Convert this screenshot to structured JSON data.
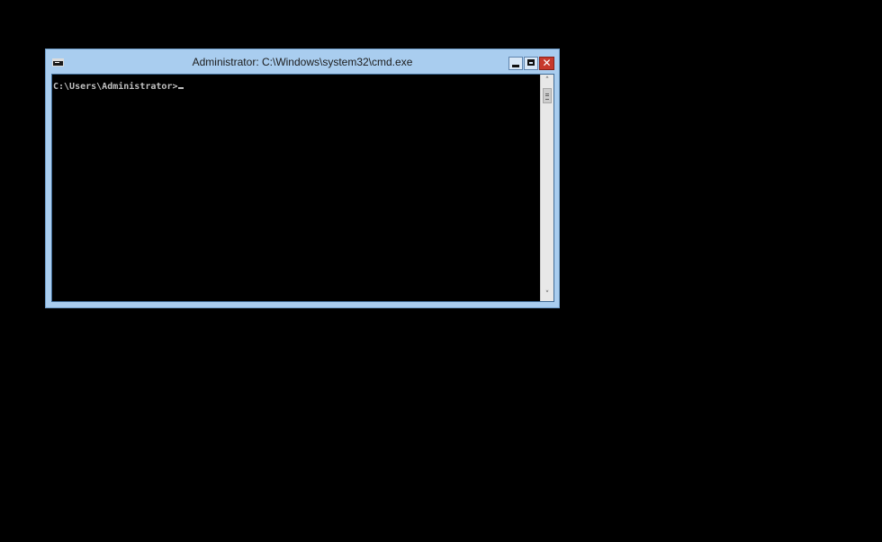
{
  "window": {
    "title": "Administrator: C:\\Windows\\system32\\cmd.exe",
    "icon": "cmd-console-icon",
    "buttons": {
      "minimize_icon": "minimize-icon",
      "maximize_icon": "maximize-icon",
      "close_icon": "close-icon",
      "close_glyph": "✕"
    }
  },
  "console": {
    "prompt": "C:\\Users\\Administrator>"
  },
  "scrollbar": {
    "up_glyph": "˄",
    "down_glyph": "˅"
  },
  "colors": {
    "desktop": "#000000",
    "window_frame": "#a9cdef",
    "console_bg": "#000000",
    "console_text": "#c0c0c0",
    "close_button": "#c7392c"
  }
}
